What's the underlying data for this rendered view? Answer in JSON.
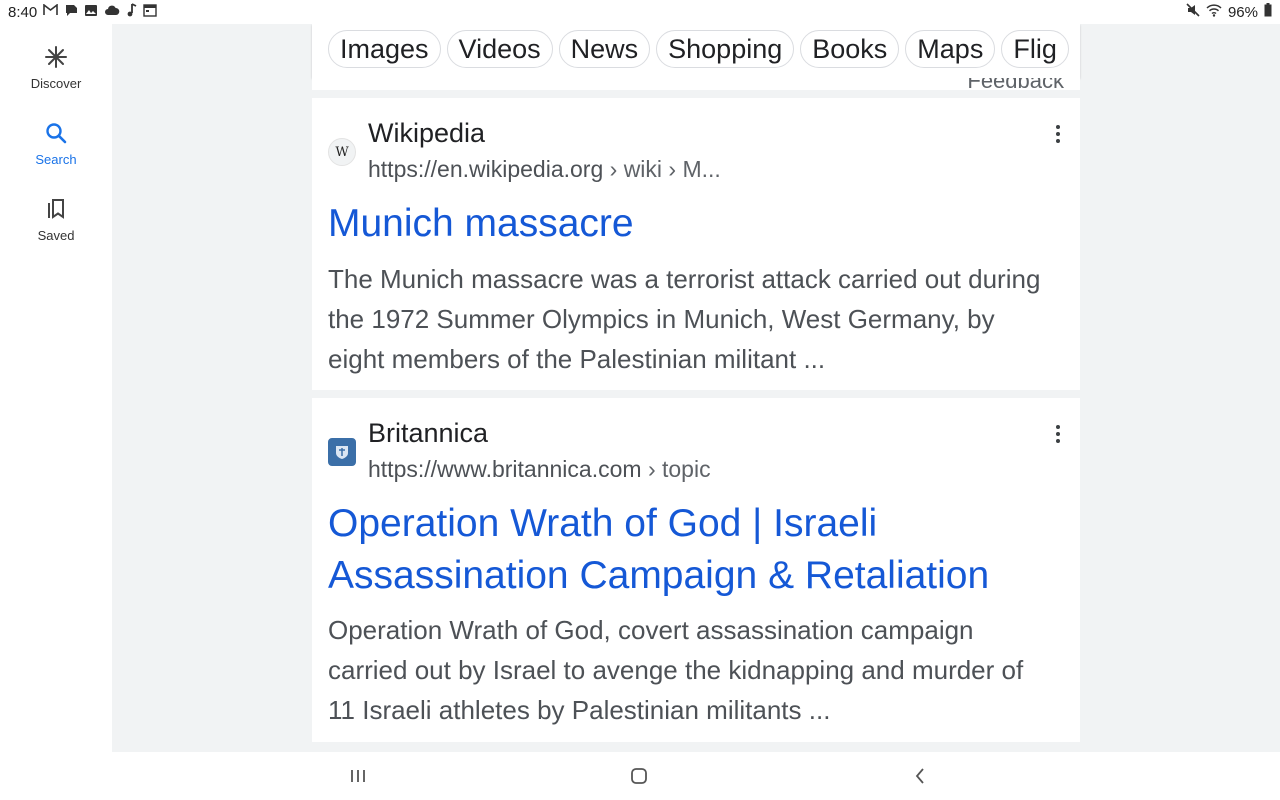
{
  "status_bar": {
    "time": "8:40",
    "left_icons": [
      "gmail-icon",
      "notification-icon",
      "image-icon",
      "cloud-icon",
      "music-icon",
      "calendar-icon"
    ],
    "battery": "96%",
    "right_icons": [
      "mute-icon",
      "wifi-icon",
      "battery-icon"
    ]
  },
  "rail": {
    "items": [
      {
        "label": "Discover",
        "icon": "asterisk-icon",
        "active": false
      },
      {
        "label": "Search",
        "icon": "search-icon",
        "active": true
      },
      {
        "label": "Saved",
        "icon": "bookmarks-icon",
        "active": false
      }
    ]
  },
  "tabs": [
    "Images",
    "Videos",
    "News",
    "Shopping",
    "Books",
    "Maps",
    "Flig"
  ],
  "feedback": "Feedback",
  "results": [
    {
      "site": "Wikipedia",
      "favicon_text": "W",
      "url": "https://en.wikipedia.org",
      "crumb": " › wiki › M...",
      "title": "Munich massacre",
      "snippet": "The Munich massacre was a terrorist attack carried out during the 1972 Summer Olympics in Munich, West Germany, by eight members of the Palestinian militant ..."
    },
    {
      "site": "Britannica",
      "favicon_text": "",
      "url": "https://www.britannica.com",
      "crumb": " › topic",
      "title": "Operation Wrath of God | Israeli Assassination Campaign & Retaliation",
      "snippet": "Operation Wrath of God, covert assassination campaign carried out by Israel to avenge the kidnapping and murder of 11 Israeli athletes by Palestinian militants ..."
    }
  ],
  "colors": {
    "link": "#1558d6",
    "accent": "#1a73e8",
    "background": "#f1f3f4"
  }
}
